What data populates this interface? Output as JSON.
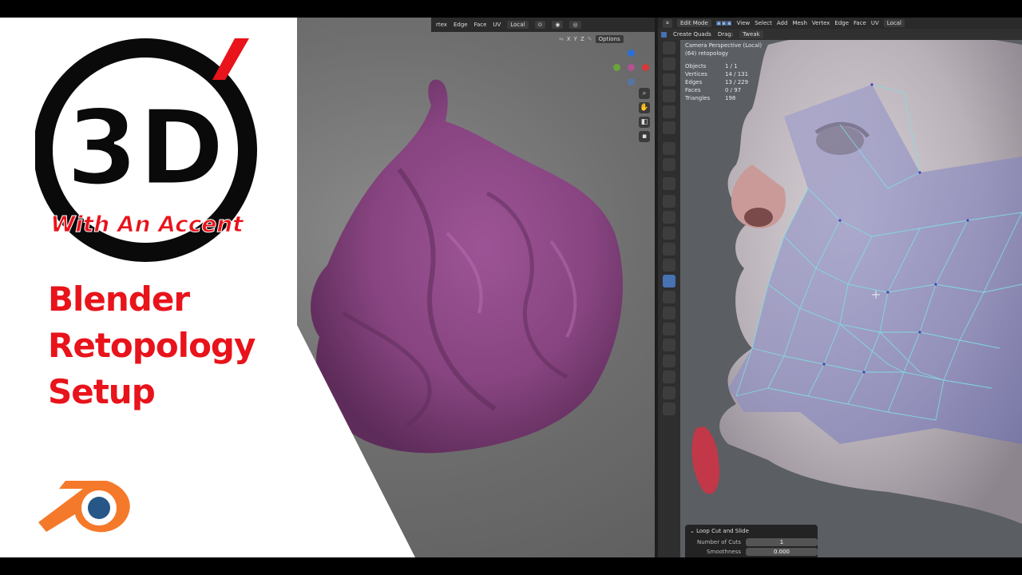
{
  "brand": {
    "logo_main": "3D",
    "logo_sub": "With An Accent",
    "title_lines": [
      "Blender",
      "Retopology",
      "Setup"
    ],
    "accent_color": "#e8131b",
    "blender_logo_colors": {
      "orange": "#f5792a",
      "blue": "#265787"
    }
  },
  "left_viewport": {
    "header_items": [
      "rtex",
      "Edge",
      "Face",
      "UV"
    ],
    "orientation": "Local",
    "axes": [
      "X",
      "Y",
      "Z"
    ],
    "options_label": "Options",
    "gizmo_axes": [
      {
        "label": "Z",
        "color": "#2a6fd8"
      },
      {
        "label": "Y",
        "color": "#6aa53b"
      },
      {
        "label": "X",
        "color": "#d9383a"
      }
    ],
    "nav_icons": [
      "zoom-icon",
      "hand-icon",
      "camera-icon",
      "lock-icon"
    ],
    "sculpt_color": "#8e4a86"
  },
  "right_viewport": {
    "mode": "Edit Mode",
    "menu": [
      "View",
      "Select",
      "Add",
      "Mesh",
      "Vertex",
      "Edge",
      "Face",
      "UV"
    ],
    "orientation": "Local",
    "create_quads_label": "Create Quads",
    "drag_label": "Drag:",
    "drag_value": "Tweak",
    "overlay_title": "Camera Perspective (Local)",
    "overlay_object": "(64) retopology",
    "stats": [
      {
        "label": "Objects",
        "value": "1 / 1"
      },
      {
        "label": "Vertices",
        "value": "14 / 131"
      },
      {
        "label": "Edges",
        "value": "13 / 229"
      },
      {
        "label": "Faces",
        "value": "0 / 97"
      },
      {
        "label": "Triangles",
        "value": "198"
      }
    ],
    "operator_panel": {
      "title": "Loop Cut and Slide",
      "fields": [
        {
          "label": "Number of Cuts",
          "value": "1"
        },
        {
          "label": "Smoothness",
          "value": "0.000"
        }
      ]
    }
  }
}
